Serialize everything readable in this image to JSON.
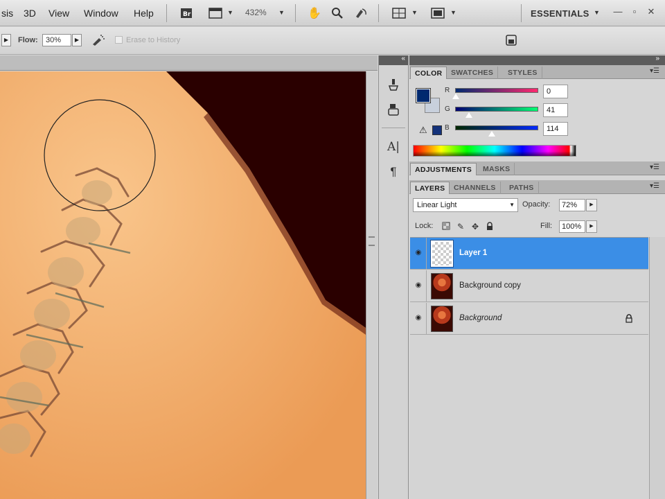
{
  "menubar": {
    "items": [
      "sis",
      "3D",
      "View",
      "Window",
      "Help"
    ],
    "zoom": "432%",
    "workspace": "ESSENTIALS",
    "icons": [
      "bridge-icon",
      "screen-mode-icon",
      "hand-tool-icon",
      "zoom-tool-icon",
      "rotate-view-icon",
      "arrange-documents-icon",
      "screen-mode-icon"
    ],
    "window_buttons": [
      "minimize-icon",
      "restore-icon",
      "close-icon"
    ]
  },
  "options": {
    "flow_label": "Flow:",
    "flow_value": "30%",
    "erase_to_history": "Erase to History"
  },
  "panels": {
    "color_tabs": [
      "COLOR",
      "SWATCHES",
      "STYLES"
    ],
    "adjust_tabs": [
      "ADJUSTMENTS",
      "MASKS"
    ],
    "layer_tabs": [
      "LAYERS",
      "CHANNELS",
      "PATHS"
    ],
    "color": {
      "foreground": "#00296f",
      "channels": [
        {
          "label": "R",
          "value": "0"
        },
        {
          "label": "G",
          "value": "41"
        },
        {
          "label": "B",
          "value": "114"
        }
      ]
    },
    "layers": {
      "blend_mode": "Linear Light",
      "opacity_label": "Opacity:",
      "opacity_value": "72%",
      "lock_label": "Lock:",
      "fill_label": "Fill:",
      "fill_value": "100%",
      "items": [
        {
          "name": "Layer 1",
          "selected": true
        },
        {
          "name": "Background copy",
          "selected": false
        },
        {
          "name": "Background",
          "selected": false,
          "locked": true
        }
      ]
    }
  },
  "colors": {
    "selection_blue": "#3b8ee6",
    "skin": "#f3ad6c",
    "dark_bg": "#2a0000"
  }
}
